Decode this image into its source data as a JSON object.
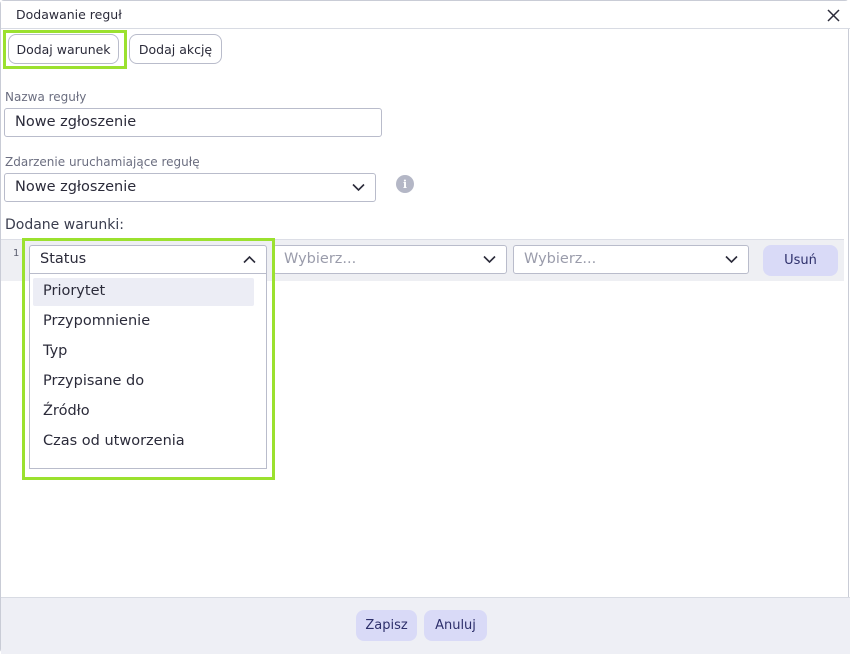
{
  "dialog": {
    "title": "Dodawanie reguł",
    "close_icon": "close-icon"
  },
  "toolbar": {
    "add_condition": "Dodaj warunek",
    "add_action": "Dodaj akcję"
  },
  "form": {
    "rule_name_label": "Nazwa reguły",
    "rule_name_value": "Nowe zgłoszenie",
    "trigger_label": "Zdarzenie uruchamiające regułę",
    "trigger_value": "Nowe zgłoszenie",
    "info_icon": "info-icon",
    "info_glyph": "i"
  },
  "conditions": {
    "label": "Dodane warunki:",
    "rows": [
      {
        "number": "1",
        "field_value": "Status",
        "operator_placeholder": "Wybierz...",
        "value_placeholder": "Wybierz...",
        "remove_label": "Usuń"
      }
    ]
  },
  "field_dropdown": {
    "highlighted": "Priorytet",
    "options": [
      "Priorytet",
      "Przypomnienie",
      "Typ",
      "Przypisane do",
      "Źródło",
      "Czas od utworzenia"
    ]
  },
  "footer": {
    "save_label": "Zapisz",
    "cancel_label": "Anuluj"
  },
  "colors": {
    "highlight_outline": "#9be12f",
    "soft_button_bg": "#d9daf7",
    "footer_bg": "#eeeff5"
  }
}
